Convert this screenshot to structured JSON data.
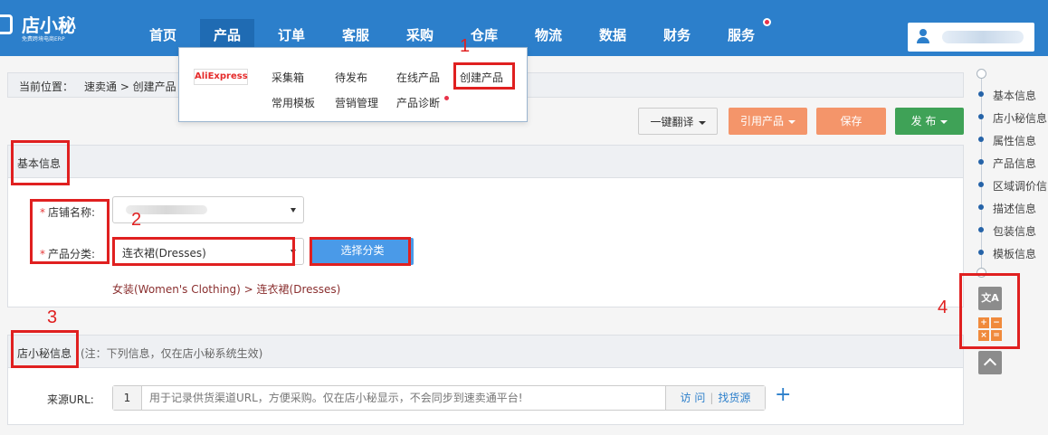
{
  "app": {
    "logo_title": "店小秘",
    "logo_subtitle": "免费跨境电商ERP"
  },
  "nav": {
    "items": [
      {
        "label": "首页"
      },
      {
        "label": "产品"
      },
      {
        "label": "订单"
      },
      {
        "label": "客服"
      },
      {
        "label": "采购"
      },
      {
        "label": "仓库"
      },
      {
        "label": "物流"
      },
      {
        "label": "数据"
      },
      {
        "label": "财务"
      },
      {
        "label": "服务"
      }
    ],
    "active": "产品"
  },
  "breadcrumb": {
    "label": "当前位置：",
    "path": "速卖通 > 创建产品"
  },
  "dropdown": {
    "platform_logo_text": "AliExpress",
    "row1": [
      "采集箱",
      "待发布",
      "在线产品",
      "创建产品"
    ],
    "row2": [
      "常用模板",
      "营销管理",
      "产品诊断"
    ]
  },
  "toolbar": {
    "translate_label": "一键翻译",
    "cite_label": "引用产品",
    "save_label": "保存",
    "publish_label": "发 布"
  },
  "basic_info": {
    "title": "基本信息",
    "store_label": "店铺名称:",
    "category_label": "产品分类:",
    "category_value": "连衣裙(Dresses)",
    "choose_button": "选择分类",
    "category_path": "女装(Women's Clothing) > 连衣裙(Dresses)"
  },
  "dxm_info": {
    "title": "店小秘信息",
    "note": "(注：下列信息，仅在店小秘系统生效)",
    "source_url_label": "来源URL:",
    "url_index": "1",
    "url_placeholder": "用于记录供货渠道URL，方便采购。仅在店小秘显示，不会同步到速卖通平台!",
    "visit_label": "访 问",
    "find_source_label": "找货源",
    "add_symbol": "+"
  },
  "side_nav": {
    "items": [
      "基本信息",
      "店小秘信息",
      "属性信息",
      "产品信息",
      "区域调价信",
      "描述信息",
      "包装信息",
      "模板信息"
    ]
  },
  "side_tools": {
    "translate_glyph": "文A",
    "calc_glyphs": [
      "+",
      "−",
      "×",
      "="
    ]
  },
  "annotations": [
    "1",
    "2",
    "3",
    "4"
  ],
  "colors": {
    "topbar": "#2c7fcb",
    "orange_button": "#f4956a",
    "green_button": "#3fa257",
    "annotation": "#e02020"
  }
}
